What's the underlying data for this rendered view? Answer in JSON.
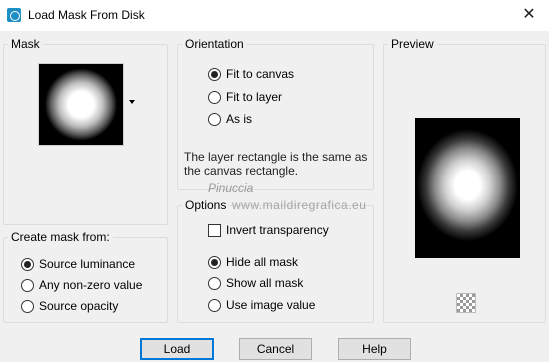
{
  "window": {
    "title": "Load Mask From Disk",
    "close_symbol": "✕"
  },
  "mask": {
    "group_label": "Mask"
  },
  "create_mask_from": {
    "group_label": "Create mask from:",
    "options": [
      {
        "label": "Source luminance",
        "checked": true
      },
      {
        "label": "Any non-zero value",
        "checked": false
      },
      {
        "label": "Source opacity",
        "checked": false
      }
    ]
  },
  "orientation": {
    "group_label": "Orientation",
    "options": [
      {
        "label": "Fit to canvas",
        "checked": true
      },
      {
        "label": "Fit to layer",
        "checked": false
      },
      {
        "label": "As is",
        "checked": false
      }
    ],
    "info": "The layer rectangle is the same as the canvas rectangle."
  },
  "options": {
    "group_label": "Options",
    "invert_label": "Invert transparency",
    "invert_checked": false,
    "radios": [
      {
        "label": "Hide all mask",
        "checked": true
      },
      {
        "label": "Show all mask",
        "checked": false
      },
      {
        "label": "Use image value",
        "checked": false
      }
    ]
  },
  "preview": {
    "group_label": "Preview"
  },
  "watermark": {
    "line1": "Pinuccia",
    "line2": "www.maildiregrafica.eu"
  },
  "buttons": {
    "load": "Load",
    "cancel": "Cancel",
    "help": "Help"
  }
}
